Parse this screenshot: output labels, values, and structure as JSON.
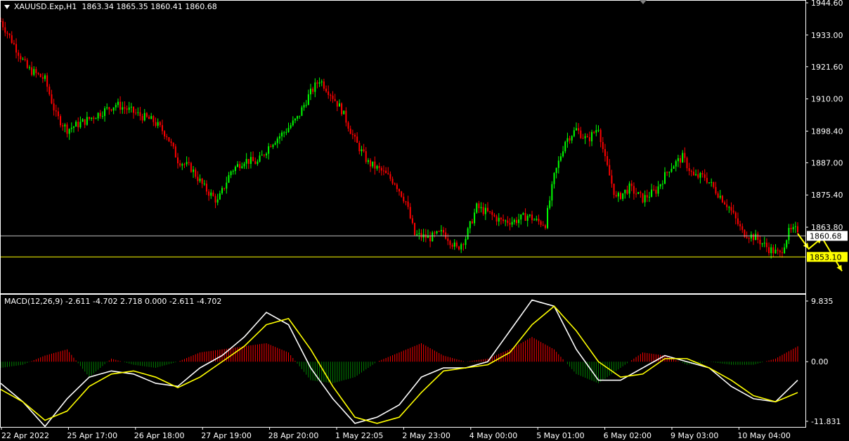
{
  "header": {
    "symbol": "XAUUSD.Exp,H1",
    "ohlc": "1863.34 1865.35 1860.41 1860.68"
  },
  "macd_header": {
    "label": "MACD(12,26,9) -2.611 -4.702 2.718 0.000 -2.611 -4.702"
  },
  "price_axis": {
    "ticks": [
      "1944.60",
      "1933.00",
      "1921.60",
      "1910.00",
      "1898.40",
      "1887.00",
      "1875.40",
      "1863.80"
    ],
    "current_price": "1860.68",
    "level_price": "1853.10"
  },
  "macd_axis": {
    "ticks": [
      "9.835",
      "0.00",
      "-11.831"
    ]
  },
  "time_axis": {
    "labels": [
      "22 Apr 2022",
      "25 Apr 17:00",
      "26 Apr 18:00",
      "27 Apr 19:00",
      "28 Apr 20:00",
      "1 May 22:05",
      "2 May 23:00",
      "4 May 00:00",
      "5 May 01:00",
      "6 May 02:00",
      "9 May 03:00",
      "10 May 04:00"
    ]
  },
  "colors": {
    "bull": "#00ff00",
    "bear": "#ff0000",
    "macd_line": "#ffffff",
    "signal_line": "#ffff00",
    "hist_pos": "#ff0000",
    "hist_neg": "#008000",
    "level": "#ffff00",
    "grid_line": "#c0c0c0",
    "arrow": "#ffff00"
  },
  "chart_data": [
    {
      "type": "candlestick",
      "title": "XAUUSD.Exp,H1",
      "ylim": [
        1840.0,
        1944.6
      ],
      "close_path": [
        [
          0,
          1938
        ],
        [
          5,
          1931
        ],
        [
          12,
          1921
        ],
        [
          20,
          1917
        ],
        [
          25,
          1904
        ],
        [
          30,
          1899
        ],
        [
          38,
          1902
        ],
        [
          45,
          1905
        ],
        [
          52,
          1908
        ],
        [
          58,
          1906
        ],
        [
          63,
          1904
        ],
        [
          69,
          1902
        ],
        [
          75,
          1897
        ],
        [
          80,
          1888
        ],
        [
          86,
          1885
        ],
        [
          92,
          1878
        ],
        [
          98,
          1873
        ],
        [
          104,
          1884
        ],
        [
          110,
          1888
        ],
        [
          116,
          1887
        ],
        [
          122,
          1894
        ],
        [
          128,
          1898
        ],
        [
          134,
          1903
        ],
        [
          139,
          1911
        ],
        [
          144,
          1917
        ],
        [
          149,
          1912
        ],
        [
          154,
          1906
        ],
        [
          160,
          1895
        ],
        [
          166,
          1887
        ],
        [
          172,
          1884
        ],
        [
          178,
          1880
        ],
        [
          183,
          1873
        ],
        [
          187,
          1861
        ],
        [
          194,
          1860
        ],
        [
          200,
          1862
        ],
        [
          206,
          1856
        ],
        [
          210,
          1860
        ],
        [
          215,
          1871
        ],
        [
          220,
          1869
        ],
        [
          226,
          1866
        ],
        [
          232,
          1866
        ],
        [
          238,
          1868
        ],
        [
          242,
          1866
        ],
        [
          246,
          1865
        ],
        [
          250,
          1882
        ],
        [
          255,
          1895
        ],
        [
          260,
          1899
        ],
        [
          265,
          1895
        ],
        [
          270,
          1900
        ],
        [
          273,
          1888
        ],
        [
          278,
          1874
        ],
        [
          284,
          1878
        ],
        [
          290,
          1874
        ],
        [
          296,
          1877
        ],
        [
          302,
          1885
        ],
        [
          308,
          1889
        ],
        [
          313,
          1882
        ],
        [
          318,
          1882
        ],
        [
          323,
          1877
        ],
        [
          329,
          1871
        ],
        [
          335,
          1862
        ],
        [
          341,
          1860
        ],
        [
          347,
          1856
        ],
        [
          352,
          1854
        ],
        [
          356,
          1862
        ],
        [
          360,
          1863
        ]
      ],
      "current_price": 1860.68,
      "level": 1853.1,
      "forecast_path": [
        [
          360,
          1861.5
        ],
        [
          365,
          1856
        ],
        [
          371,
          1860
        ],
        [
          380,
          1848
        ]
      ]
    },
    {
      "type": "line",
      "title": "MACD(12,26,9)",
      "ylim": [
        -11.831,
        9.835
      ],
      "series": [
        {
          "name": "MACD",
          "x": [
            0,
            10,
            20,
            30,
            40,
            50,
            60,
            70,
            80,
            90,
            100,
            110,
            120,
            130,
            140,
            150,
            160,
            170,
            180,
            190,
            200,
            210,
            220,
            230,
            240,
            250,
            260,
            270,
            280,
            290,
            300,
            310,
            320,
            330,
            340,
            350,
            360
          ],
          "values": [
            -3.5,
            -6.5,
            -10.5,
            -6,
            -2.5,
            -1.5,
            -2,
            -3.5,
            -4,
            -1,
            1,
            4,
            8,
            6,
            -1,
            -6,
            -10,
            -9,
            -7,
            -2.5,
            -1,
            -1,
            0,
            5,
            10,
            9,
            2,
            -3,
            -3,
            -1,
            1,
            0,
            -1,
            -4,
            -6,
            -6.5,
            -3
          ]
        },
        {
          "name": "Signal",
          "x": [
            0,
            10,
            20,
            30,
            40,
            50,
            60,
            70,
            80,
            90,
            100,
            110,
            120,
            130,
            140,
            150,
            160,
            170,
            180,
            190,
            200,
            210,
            220,
            230,
            240,
            250,
            260,
            270,
            280,
            290,
            300,
            310,
            320,
            330,
            340,
            350,
            360
          ],
          "values": [
            -4.5,
            -6.5,
            -9.5,
            -8,
            -4,
            -2,
            -1.5,
            -2.5,
            -4.2,
            -2.5,
            0,
            2.5,
            6,
            7,
            2,
            -4,
            -9,
            -10,
            -9,
            -5,
            -1.5,
            -1,
            -0.5,
            1.5,
            6,
            9,
            5,
            0,
            -2.5,
            -2,
            0.5,
            0.5,
            -1,
            -3,
            -5.5,
            -6.5,
            -5
          ]
        }
      ],
      "histogram_x": [
        0,
        10,
        20,
        30,
        40,
        50,
        60,
        70,
        80,
        90,
        100,
        110,
        120,
        130,
        140,
        150,
        160,
        170,
        180,
        190,
        200,
        210,
        220,
        230,
        240,
        250,
        260,
        270,
        280,
        290,
        300,
        310,
        320,
        330,
        340,
        350,
        360
      ],
      "histogram": [
        -1,
        -0.5,
        1,
        2,
        -2.5,
        0.5,
        -0.5,
        -1,
        0,
        1.5,
        2,
        2.5,
        3,
        1.5,
        -3,
        -3.5,
        -2.5,
        0,
        1.5,
        3,
        1,
        0,
        0.5,
        2,
        4,
        2,
        -2,
        -3.5,
        -1,
        1.5,
        1,
        -0.5,
        0,
        -0.5,
        -0.5,
        0.5,
        2.5
      ]
    }
  ]
}
